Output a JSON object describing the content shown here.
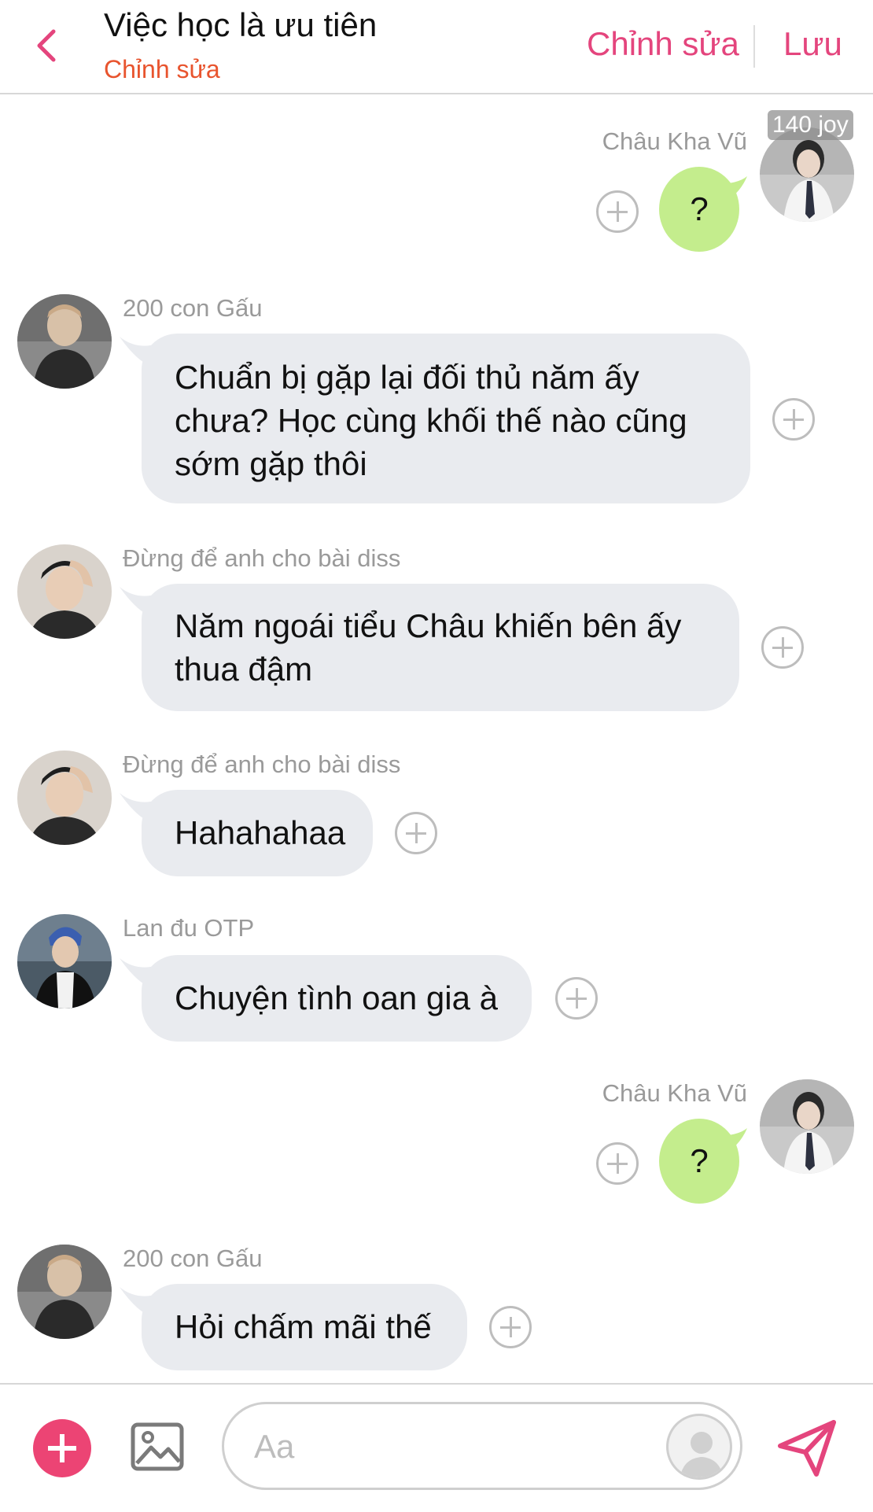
{
  "header": {
    "title": "Việc học là ưu tiên",
    "subtitle": "Chỉnh sửa",
    "edit_label": "Chỉnh sửa",
    "save_label": "Lưu"
  },
  "badge": {
    "text": "140 joy"
  },
  "messages": [
    {
      "sender": "Châu Kha Vũ",
      "side": "right",
      "text": "?"
    },
    {
      "sender": "200 con Gấu",
      "side": "left",
      "lines": [
        "Chuẩn bị gặp lại đối thủ năm ấy",
        "chưa? Học cùng khối thế nào cũng",
        "sớm gặp thôi"
      ]
    },
    {
      "sender": "Đừng để anh cho bài diss",
      "side": "left",
      "lines": [
        "Năm ngoái tiểu Châu khiến bên ấy",
        "thua đậm"
      ]
    },
    {
      "sender": "Đừng để anh cho bài diss",
      "side": "left",
      "text": "Hahahahaa"
    },
    {
      "sender": "Lan đu OTP",
      "side": "left",
      "text": "Chuyện tình oan gia à"
    },
    {
      "sender": "Châu Kha Vũ",
      "side": "right",
      "text": "?"
    },
    {
      "sender": "200 con Gấu",
      "side": "left",
      "text": "Hỏi chấm mãi thế"
    }
  ],
  "composer": {
    "placeholder": "Aa"
  },
  "colors": {
    "accent": "#e4457d",
    "subtitle": "#e8542e",
    "bubble_gray": "#e9ebef",
    "bubble_green": "#c4ed8d"
  },
  "icons": [
    "chevron-left-icon",
    "plus-circle-icon",
    "image-icon",
    "avatar-placeholder-icon",
    "send-icon"
  ]
}
